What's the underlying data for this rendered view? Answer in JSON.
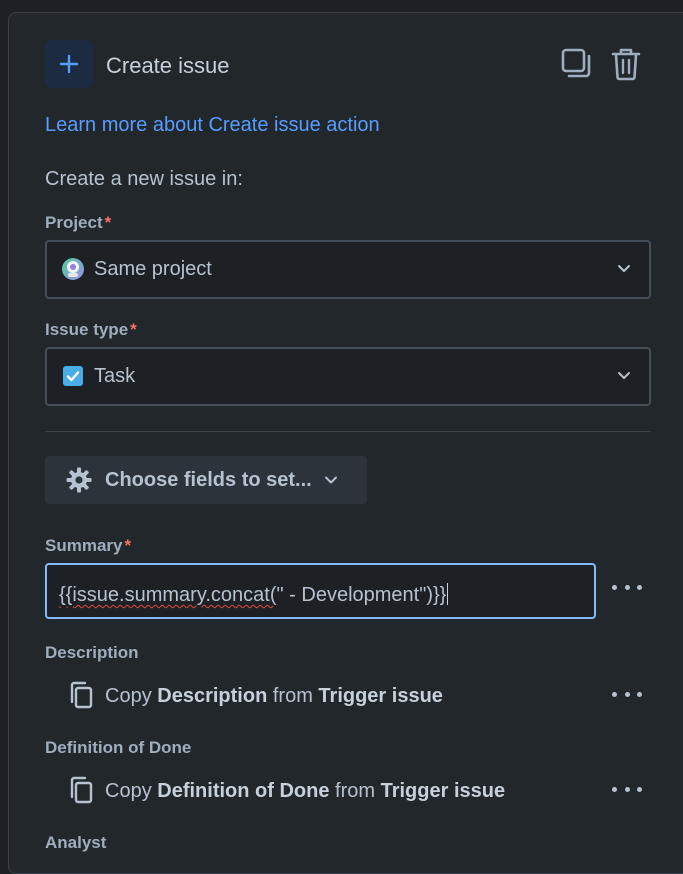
{
  "header": {
    "title": "Create issue",
    "plus_icon": "plus-icon",
    "duplicate_icon": "duplicate-icon",
    "delete_icon": "trash-icon"
  },
  "learn_more_link": "Learn more about Create issue action",
  "intro_text": "Create a new issue in:",
  "project": {
    "label": "Project",
    "required_mark": "*",
    "value": "Same project",
    "icon": "project-avatar-icon"
  },
  "issue_type": {
    "label": "Issue type",
    "required_mark": "*",
    "value": "Task",
    "icon": "task-checkbox-icon"
  },
  "choose_fields_button": "Choose fields to set...",
  "summary": {
    "label": "Summary",
    "required_mark": "*",
    "value_underlined": "{{issue.summary.concat(",
    "value_rest": "\" - Development\")}}"
  },
  "description": {
    "label": "Description",
    "copy_prefix": "Copy",
    "field_name": "Description",
    "from_text": "from",
    "source": "Trigger issue"
  },
  "definition_of_done": {
    "label": "Definition of Done",
    "copy_prefix": "Copy",
    "field_name": "Definition of Done",
    "from_text": "from",
    "source": "Trigger issue"
  },
  "analyst": {
    "label": "Analyst"
  },
  "colors": {
    "accent_link": "#579dff",
    "focus_border": "#85b8ff",
    "required": "#f87168"
  }
}
